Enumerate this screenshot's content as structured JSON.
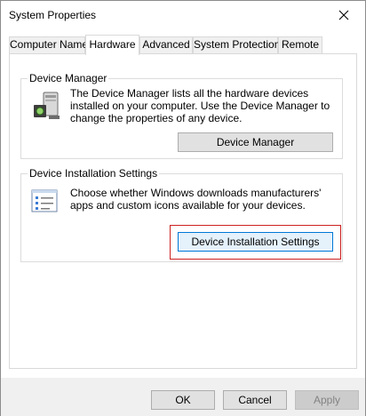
{
  "window": {
    "title": "System Properties"
  },
  "tabs": [
    {
      "label": "Computer Name",
      "active": false
    },
    {
      "label": "Hardware",
      "active": true
    },
    {
      "label": "Advanced",
      "active": false
    },
    {
      "label": "System Protection",
      "active": false
    },
    {
      "label": "Remote",
      "active": false
    }
  ],
  "device_manager": {
    "legend": "Device Manager",
    "description": "The Device Manager lists all the hardware devices installed on your computer. Use the Device Manager to change the properties of any device.",
    "button_label": "Device Manager",
    "icon": "device-manager-icon"
  },
  "device_installation": {
    "legend": "Device Installation Settings",
    "description": "Choose whether Windows downloads manufacturers' apps and custom icons available for your devices.",
    "button_label": "Device Installation Settings",
    "icon": "checklist-icon",
    "highlight_color": "#cc2020"
  },
  "footer": {
    "ok_label": "OK",
    "cancel_label": "Cancel",
    "apply_label": "Apply"
  },
  "colors": {
    "accent": "#0078d7",
    "button_face": "#e1e1e1",
    "footer_bg": "#f0f0f0"
  }
}
